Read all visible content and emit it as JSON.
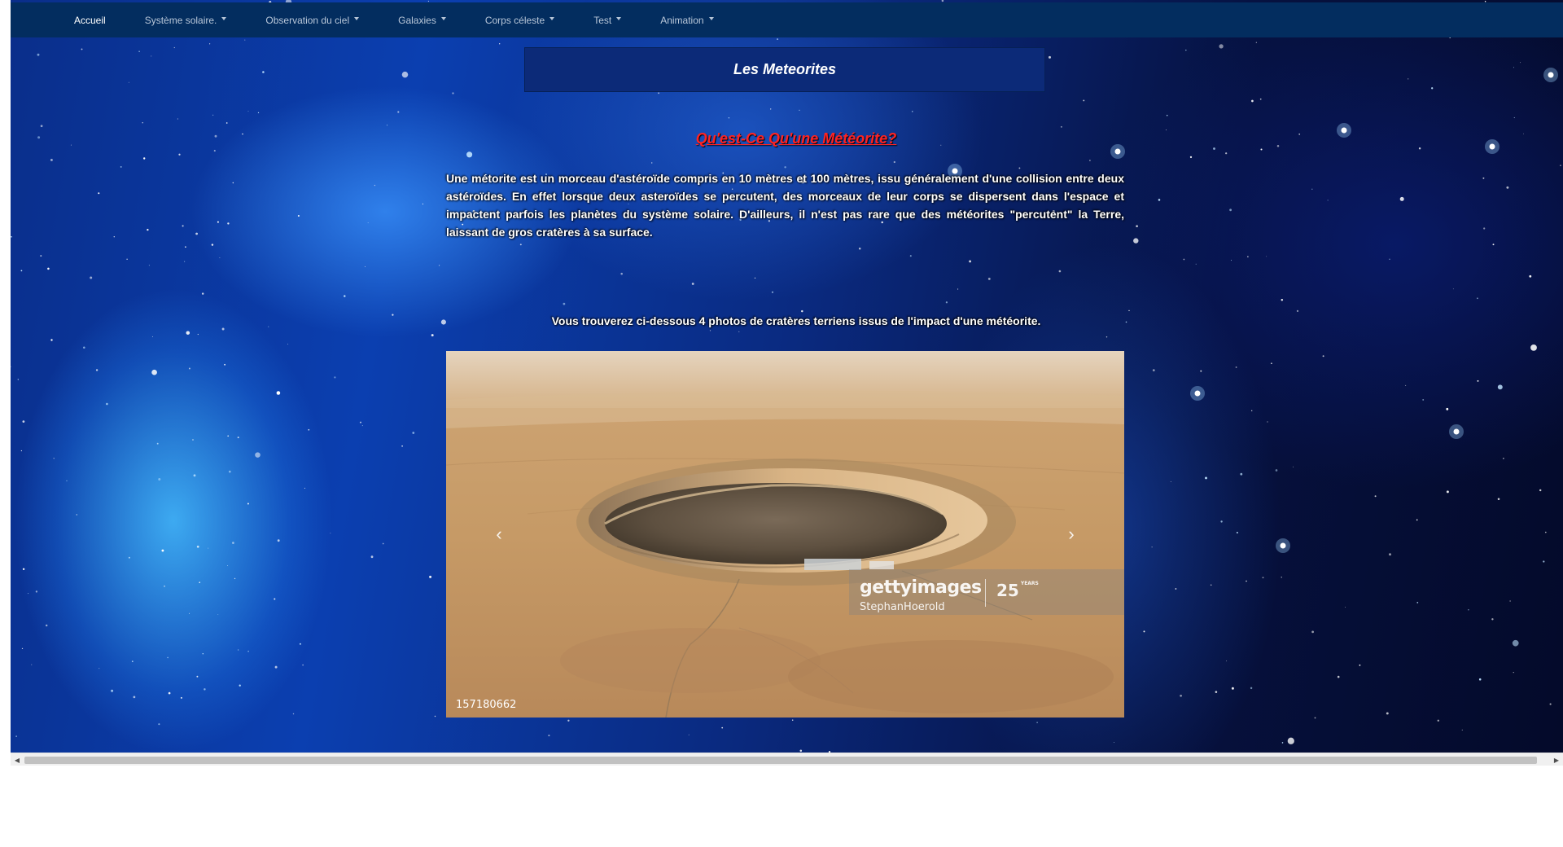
{
  "nav": {
    "items": [
      {
        "label": "Accueil",
        "dropdown": false,
        "active": true
      },
      {
        "label": "Système solaire.",
        "dropdown": true
      },
      {
        "label": "Observation du ciel",
        "dropdown": true
      },
      {
        "label": "Galaxies",
        "dropdown": true
      },
      {
        "label": "Corps céleste",
        "dropdown": true
      },
      {
        "label": "Test",
        "dropdown": true
      },
      {
        "label": "Animation",
        "dropdown": true
      }
    ]
  },
  "page": {
    "title": "Les Meteorites",
    "subtitle": "Qu'est-Ce Qu'une Météorite?",
    "intro": "Une métorite est un morceau d'astéroïde compris en 10 mètres et 100 mètres, issu généralement d'une collision entre deux astéroïdes. En effet lorsque deux asteroïdes se percutent, des morceaux de leur corps se dispersent dans l'espace et impactent parfois les planètes du système solaire. D'ailleurs, il n'est pas rare que des météorites \"percutent\" la Terre, laissant de gros cratères à sa surface.",
    "caption": "Vous trouverez ci-dessous 4 photos de cratères terriens issus de l'impact d'une météorite."
  },
  "carousel": {
    "prev_icon": "chevron-left-icon",
    "next_icon": "chevron-right-icon",
    "prev_glyph": "‹",
    "next_glyph": "›",
    "watermark": "gettyimages",
    "watermark_author": "StephanHoerold",
    "watermark_years": "25",
    "watermark_years_small": "YEARS",
    "photo_id": "157180662"
  },
  "scrollbar": {
    "left_glyph": "◀",
    "right_glyph": "▶"
  },
  "colors": {
    "navbar": "#032d5f",
    "title_box": "#0c2a78",
    "subtitle": "#ff2323"
  }
}
